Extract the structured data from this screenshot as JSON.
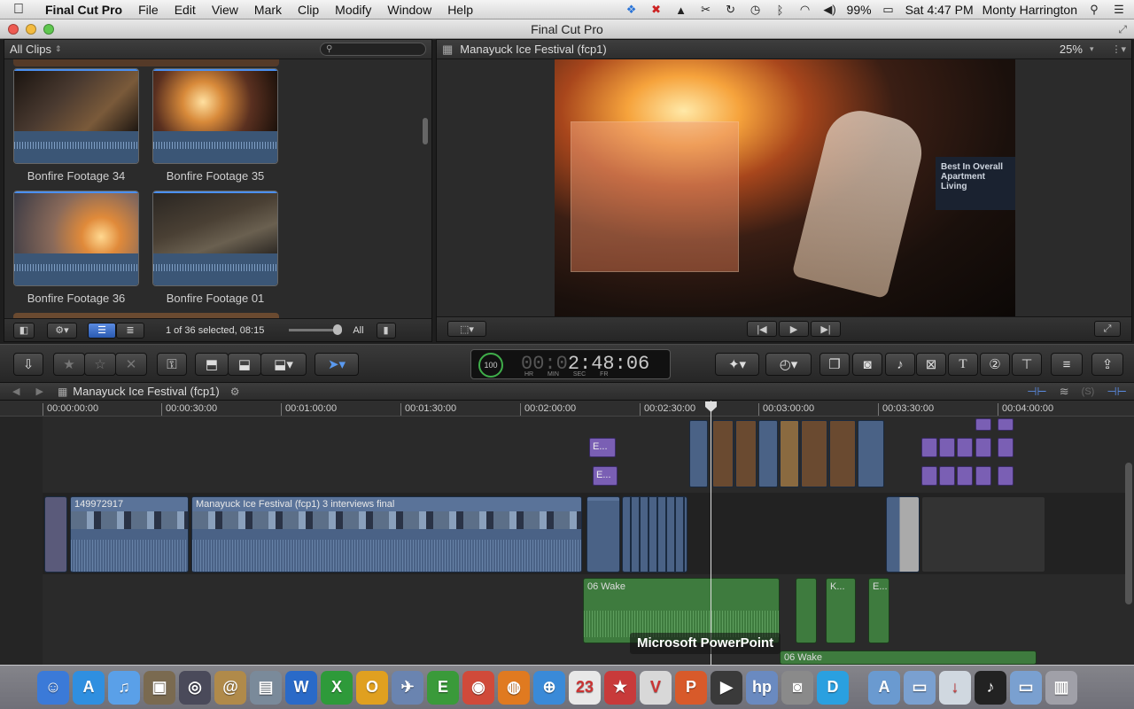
{
  "menubar": {
    "apple": "",
    "app_name": "Final Cut Pro",
    "items": [
      "File",
      "Edit",
      "View",
      "Mark",
      "Clip",
      "Modify",
      "Window",
      "Help"
    ],
    "battery": "99%",
    "clock": "Sat 4:47 PM",
    "user": "Monty Harrington"
  },
  "window": {
    "title": "Final Cut Pro"
  },
  "browser": {
    "filter": "All Clips",
    "clips": [
      {
        "label": "Bonfire Footage 34",
        "color": "#5a3a24"
      },
      {
        "label": "Bonfire Footage 35",
        "color": "#b06a2c"
      },
      {
        "label": "Bonfire Footage 36",
        "color": "#d08a44"
      },
      {
        "label": "Bonfire Footage 01",
        "color": "#3a3026"
      }
    ],
    "status": "1 of 36 selected, 08:15",
    "zoom_label": "All"
  },
  "viewer": {
    "title": "Manayuck Ice Festival (fcp1)",
    "zoom": "25%",
    "sign_text": "Best In Overall Apartment Living"
  },
  "toolbar": {
    "timecode": "00:02:48:06",
    "timecode_dim": "00:0",
    "timecode_bright": "2:48:06",
    "timecode_units": "HR MIN SEC FR",
    "dial_value": "100"
  },
  "timeline": {
    "project": "Manayuck Ice Festival (fcp1)",
    "ruler": [
      "00:00:00:00",
      "00:00:30:00",
      "00:01:00:00",
      "00:01:30:00",
      "00:02:00:00",
      "00:02:30:00",
      "00:03:00:00",
      "00:03:30:00",
      "00:04:00:00"
    ],
    "clip_a": "149972917",
    "clip_b": "Manayuck Ice Festival (fcp1) 3 interviews final",
    "title_a": "E...",
    "title_b": "E...",
    "audio_a": "06 Wake",
    "audio_b": "K...",
    "audio_c": "E...",
    "audio_d": "06 Wake"
  },
  "tooltip": "Microsoft PowerPoint",
  "dock": [
    {
      "name": "Finder",
      "glyph": "☺",
      "color": "#3b7ad8"
    },
    {
      "name": "App Store",
      "glyph": "A",
      "color": "#2f8fe0"
    },
    {
      "name": "iTunes",
      "glyph": "♫",
      "color": "#5aa0e8"
    },
    {
      "name": "iPhoto",
      "glyph": "▣",
      "color": "#7a6a50"
    },
    {
      "name": "Aperture",
      "glyph": "◎",
      "color": "#4a4a5a"
    },
    {
      "name": "Contacts",
      "glyph": "@",
      "color": "#b08a4a"
    },
    {
      "name": "Preview",
      "glyph": "▤",
      "color": "#7a8a9a"
    },
    {
      "name": "Word",
      "glyph": "W",
      "color": "#2a6ac8"
    },
    {
      "name": "Excel",
      "glyph": "X",
      "color": "#2e9a3a"
    },
    {
      "name": "Outlook",
      "glyph": "O",
      "color": "#e0a020"
    },
    {
      "name": "Preview Eagle",
      "glyph": "✈",
      "color": "#6a84b0"
    },
    {
      "name": "Evernote",
      "glyph": "E",
      "color": "#3a9a3a"
    },
    {
      "name": "Chrome",
      "glyph": "◉",
      "color": "#d04a3a"
    },
    {
      "name": "Firefox",
      "glyph": "◍",
      "color": "#e07a20"
    },
    {
      "name": "Safari",
      "glyph": "⊕",
      "color": "#3a8ad8"
    },
    {
      "name": "Calendar",
      "glyph": "23",
      "color": "#e8e8e8"
    },
    {
      "name": "Tasks",
      "glyph": "★",
      "color": "#c83a3a"
    },
    {
      "name": "VNC",
      "glyph": "V",
      "color": "#d8d8d8"
    },
    {
      "name": "PowerPoint",
      "glyph": "P",
      "color": "#d85a2a"
    },
    {
      "name": "Final Cut Pro",
      "glyph": "▶",
      "color": "#3a3a3a"
    },
    {
      "name": "HP",
      "glyph": "hp",
      "color": "#6a8ac0"
    },
    {
      "name": "Image Capture",
      "glyph": "◙",
      "color": "#8a8a8a"
    },
    {
      "name": "Dashboard",
      "glyph": "D",
      "color": "#2aa0e0"
    },
    {
      "name": "Applications",
      "glyph": "A",
      "color": "#6a9ad0"
    },
    {
      "name": "Documents",
      "glyph": "▭",
      "color": "#7aa0d0"
    },
    {
      "name": "Downloads",
      "glyph": "↓",
      "color": "#d0d8e0"
    },
    {
      "name": "Music Stack",
      "glyph": "♪",
      "color": "#222"
    },
    {
      "name": "Folder",
      "glyph": "▭",
      "color": "#7aa0d0"
    },
    {
      "name": "Trash",
      "glyph": "▥",
      "color": "#a0a0a8"
    }
  ]
}
